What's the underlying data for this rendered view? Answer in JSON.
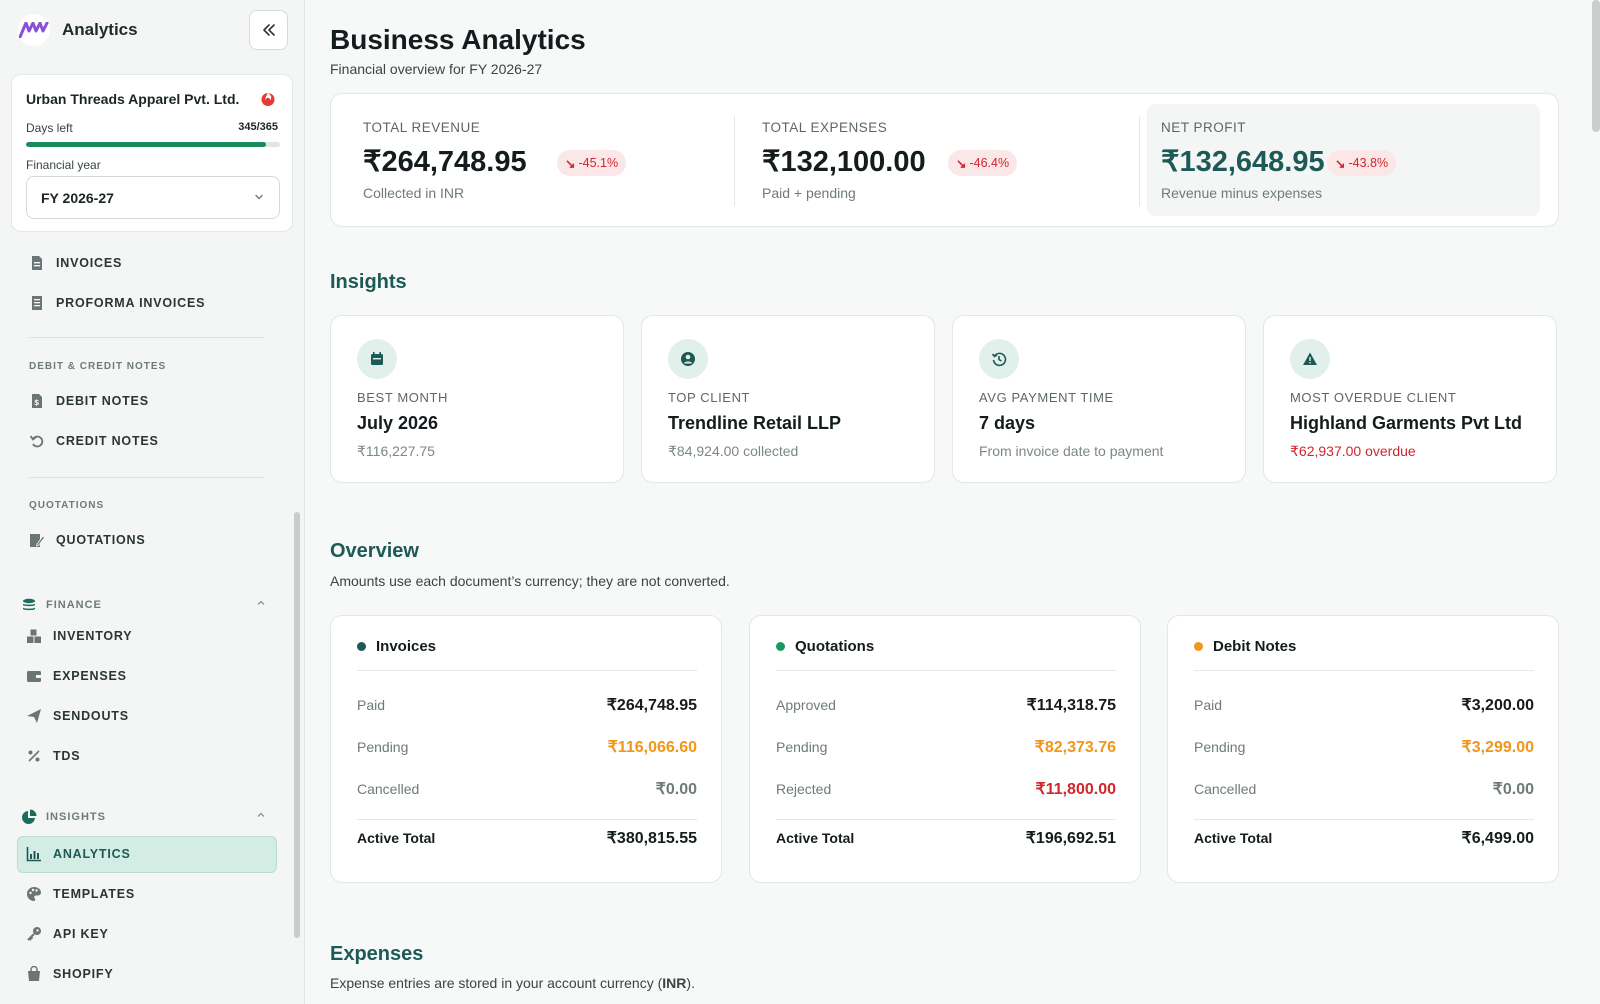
{
  "brand": {
    "title": "Analytics"
  },
  "company": {
    "name": "Urban Threads Apparel Pvt. Ltd.",
    "days_label": "Days left",
    "days_value": "345/365",
    "days_progress": 0.945,
    "fy_label": "Financial year",
    "fy_value": "FY 2026-27"
  },
  "nav": {
    "invoices": "INVOICES",
    "proforma": "PROFORMA INVOICES",
    "section_debit": "DEBIT & CREDIT NOTES",
    "debit_notes": "DEBIT NOTES",
    "credit_notes": "CREDIT NOTES",
    "section_quotations": "QUOTATIONS",
    "quotations": "QUOTATIONS",
    "group_finance": "FINANCE",
    "inventory": "INVENTORY",
    "expenses": "EXPENSES",
    "sendouts": "SENDOUTS",
    "tds": "TDS",
    "group_insights": "INSIGHTS",
    "analytics": "ANALYTICS",
    "templates": "TEMPLATES",
    "api_key": "API KEY",
    "shopify": "SHOPIFY"
  },
  "header": {
    "title": "Business Analytics",
    "subtitle": "Financial overview for FY 2026-27"
  },
  "kpis": [
    {
      "label": "TOTAL REVENUE",
      "value": "₹264,748.95",
      "change": "-45.1%",
      "sub": "Collected in INR"
    },
    {
      "label": "TOTAL EXPENSES",
      "value": "₹132,100.00",
      "change": "-46.4%",
      "sub": "Paid + pending"
    },
    {
      "label": "NET PROFIT",
      "value": "₹132,648.95",
      "change": "-43.8%",
      "sub": "Revenue minus expenses"
    }
  ],
  "insights": {
    "title": "Insights",
    "cards": [
      {
        "label": "BEST MONTH",
        "value": "July 2026",
        "sub": "₹116,227.75",
        "icon": "calendar-icon"
      },
      {
        "label": "TOP CLIENT",
        "value": "Trendline Retail LLP",
        "sub": "₹84,924.00 collected",
        "icon": "user-circle-icon"
      },
      {
        "label": "AVG PAYMENT TIME",
        "value": "7 days",
        "sub": "From invoice date to payment",
        "icon": "history-icon"
      },
      {
        "label": "MOST OVERDUE CLIENT",
        "value": "Highland Garments Pvt Ltd",
        "sub": "₹62,937.00 overdue",
        "icon": "warning-icon"
      }
    ]
  },
  "overview": {
    "title": "Overview",
    "subtitle": "Amounts use each document’s currency; they are not converted.",
    "cards": [
      {
        "title": "Invoices",
        "dot_color": "#1d5a55",
        "rows": [
          {
            "label": "Paid",
            "value": "₹264,748.95"
          },
          {
            "label": "Pending",
            "value": "₹116,066.60"
          },
          {
            "label": "Cancelled",
            "value": "₹0.00"
          }
        ],
        "total_label": "Active Total",
        "total_value": "₹380,815.55"
      },
      {
        "title": "Quotations",
        "dot_color": "#1a9a62",
        "rows": [
          {
            "label": "Approved",
            "value": "₹114,318.75"
          },
          {
            "label": "Pending",
            "value": "₹82,373.76"
          },
          {
            "label": "Rejected",
            "value": "₹11,800.00"
          }
        ],
        "total_label": "Active Total",
        "total_value": "₹196,692.51"
      },
      {
        "title": "Debit Notes",
        "dot_color": "#f0961a",
        "rows": [
          {
            "label": "Paid",
            "value": "₹3,200.00"
          },
          {
            "label": "Pending",
            "value": "₹3,299.00"
          },
          {
            "label": "Cancelled",
            "value": "₹0.00"
          }
        ],
        "total_label": "Active Total",
        "total_value": "₹6,499.00"
      }
    ]
  },
  "expenses": {
    "title": "Expenses",
    "subtitle_pre": "Expense entries are stored in your account currency (",
    "subtitle_bold": "INR",
    "subtitle_post": ")."
  },
  "colors": {
    "accent": "#1d5a55",
    "positive": "#1a8a5a",
    "negative": "#d0262e",
    "warning": "#f0961a"
  }
}
